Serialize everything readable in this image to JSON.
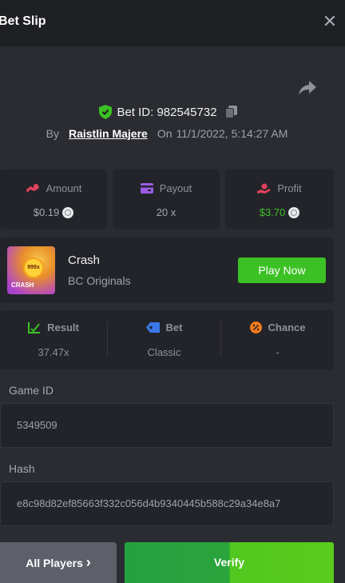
{
  "header": {
    "title": "Bet Slip",
    "close_glyph": "✕"
  },
  "bet": {
    "id_text": "Bet ID: 982545732",
    "by_label": "By",
    "user": "Raistlin Majere",
    "on_label": "On",
    "datetime": "11/1/2022, 5:14:27 AM"
  },
  "stats": [
    {
      "icon": "amount-icon",
      "label": "Amount",
      "value": "$0.19",
      "color": "#a5a8b0",
      "coin": true
    },
    {
      "icon": "payout-icon",
      "label": "Payout",
      "value": "20 x",
      "color": "#a5a8b0",
      "coin": false
    },
    {
      "icon": "profit-icon",
      "label": "Profit",
      "value": "$3.70",
      "color": "#3ec22a",
      "coin": true
    }
  ],
  "game": {
    "name": "Crash",
    "provider": "BC Originals",
    "play_label": "Play Now",
    "thumb_badge": "999x",
    "thumb_label": "CRASH"
  },
  "result_card": [
    {
      "icon": "result-icon",
      "label": "Result",
      "value": "37.47x"
    },
    {
      "icon": "bet-tag-icon",
      "label": "Bet",
      "value": "Classic"
    },
    {
      "icon": "chance-icon",
      "label": "Chance",
      "value": "-"
    }
  ],
  "fields": {
    "game_id_label": "Game ID",
    "game_id_value": "5349509",
    "hash_label": "Hash",
    "hash_value": "e8c98d82ef85663f332c056d4b9340445b588c29a34e8a7"
  },
  "footer": {
    "all_players_label": "All Players",
    "all_players_chevron": "›",
    "verify_label": "Verify"
  },
  "colors": {
    "accent_green": "#3cc125",
    "profit_green": "#3ec22a",
    "panel": "#232429",
    "background": "#2b2c31"
  }
}
